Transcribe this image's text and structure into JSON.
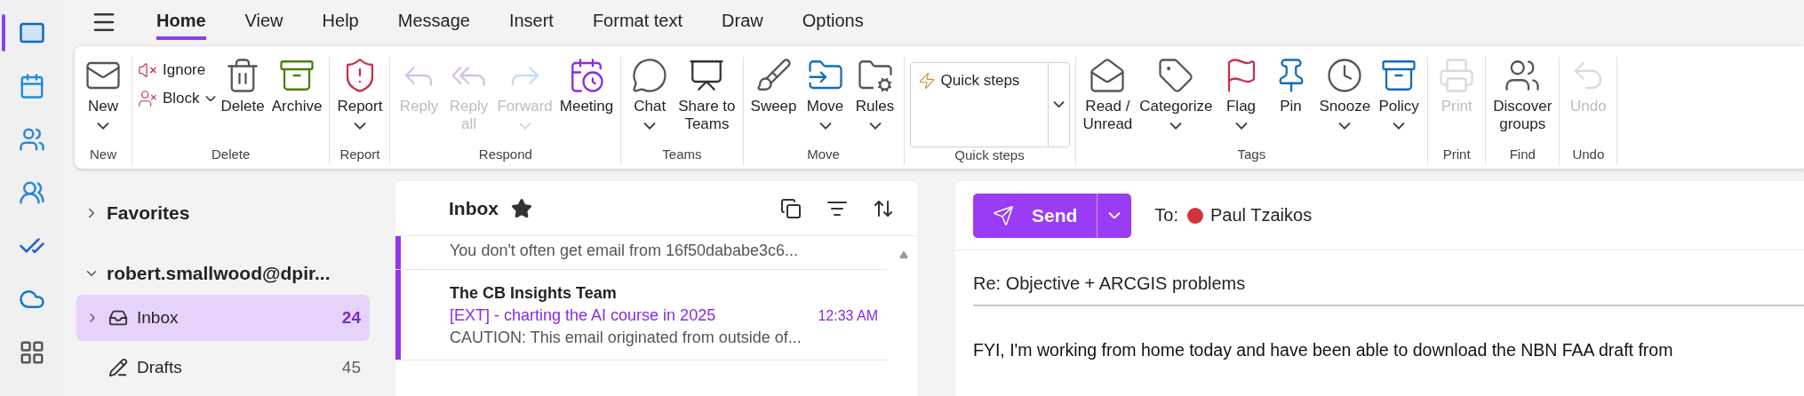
{
  "app_rail": [
    {
      "selected": true
    },
    {
      "selected": false
    },
    {
      "selected": false
    },
    {
      "selected": false
    },
    {
      "selected": false
    },
    {
      "selected": false
    },
    {
      "selected": false
    }
  ],
  "tabs": [
    {
      "label": "Home",
      "selected": true
    },
    {
      "label": "View",
      "selected": false
    },
    {
      "label": "Help",
      "selected": false
    },
    {
      "label": "Message",
      "selected": false
    },
    {
      "label": "Insert",
      "selected": false
    },
    {
      "label": "Format text",
      "selected": false
    },
    {
      "label": "Draw",
      "selected": false
    },
    {
      "label": "Options",
      "selected": false
    }
  ],
  "ribbon": {
    "groups": [
      {
        "label": "New",
        "items": [
          {
            "kind": "large",
            "label": "New",
            "dropdown": true,
            "disabled": false
          }
        ]
      },
      {
        "label": "Delete",
        "items": [
          {
            "kind": "small",
            "label": "Ignore",
            "dropdown": false,
            "disabled": false
          },
          {
            "kind": "small",
            "label": "Block",
            "dropdown": true,
            "disabled": false
          },
          {
            "kind": "large",
            "label": "Delete",
            "dropdown": false,
            "disabled": false
          },
          {
            "kind": "large",
            "label": "Archive",
            "dropdown": false,
            "disabled": false
          }
        ]
      },
      {
        "label": "Report",
        "items": [
          {
            "kind": "large",
            "label": "Report",
            "dropdown": true,
            "disabled": false
          }
        ]
      },
      {
        "label": "Respond",
        "items": [
          {
            "kind": "large",
            "label": "Reply",
            "dropdown": false,
            "disabled": true
          },
          {
            "kind": "large",
            "label": "Reply\nall",
            "dropdown": false,
            "disabled": true
          },
          {
            "kind": "large",
            "label": "Forward",
            "dropdown": true,
            "disabled": true
          },
          {
            "kind": "large",
            "label": "Meeting",
            "dropdown": false,
            "disabled": false
          }
        ]
      },
      {
        "label": "Teams",
        "items": [
          {
            "kind": "large",
            "label": "Chat",
            "dropdown": true,
            "disabled": false
          },
          {
            "kind": "large",
            "label": "Share to\nTeams",
            "dropdown": false,
            "disabled": false
          }
        ]
      },
      {
        "label": "Move",
        "items": [
          {
            "kind": "large",
            "label": "Sweep",
            "dropdown": false,
            "disabled": false
          },
          {
            "kind": "large",
            "label": "Move",
            "dropdown": true,
            "disabled": false
          },
          {
            "kind": "large",
            "label": "Rules",
            "dropdown": true,
            "disabled": false
          }
        ]
      },
      {
        "label": "Quick steps",
        "items": [
          {
            "kind": "gallery",
            "label": "Quick steps",
            "dropdown": true
          }
        ]
      },
      {
        "label": "Tags",
        "items": [
          {
            "kind": "large",
            "label": "Read /\nUnread",
            "dropdown": false,
            "disabled": false
          },
          {
            "kind": "large",
            "label": "Categorize",
            "dropdown": true,
            "disabled": false
          },
          {
            "kind": "large",
            "label": "Flag",
            "dropdown": true,
            "disabled": false
          },
          {
            "kind": "large",
            "label": "Pin",
            "dropdown": false,
            "disabled": false
          },
          {
            "kind": "large",
            "label": "Snooze",
            "dropdown": true,
            "disabled": false
          },
          {
            "kind": "large",
            "label": "Policy",
            "dropdown": true,
            "disabled": false
          }
        ]
      },
      {
        "label": "Print",
        "items": [
          {
            "kind": "large",
            "label": "Print",
            "dropdown": false,
            "disabled": true
          }
        ]
      },
      {
        "label": "Find",
        "items": [
          {
            "kind": "large",
            "label": "Discover\ngroups",
            "dropdown": false,
            "disabled": false
          }
        ]
      },
      {
        "label": "Undo",
        "items": [
          {
            "kind": "large",
            "label": "Undo",
            "dropdown": false,
            "disabled": true
          }
        ]
      }
    ]
  },
  "folders": [
    {
      "label": "Favorites",
      "expanded": false
    },
    {
      "label": "robert.smallwood@dpir...",
      "expanded": true,
      "children": [
        {
          "label": "Inbox",
          "count": "24",
          "selected": true,
          "expanded": false
        },
        {
          "label": "Drafts",
          "count": "45",
          "selected": false
        }
      ]
    }
  ],
  "message_list": {
    "title": "Inbox",
    "items": [
      {
        "unread": true,
        "preview": "You don't often get email from 16f50dababe3c6..."
      },
      {
        "unread": true,
        "sender": "The CB Insights Team",
        "subject": "[EXT] - charting the AI course in 2025",
        "time": "12:33 AM",
        "preview": "CAUTION: This email originated from outside of..."
      }
    ]
  },
  "compose": {
    "send_label": "Send",
    "to_label": "To:",
    "recipients": [
      {
        "name": "Paul Tzaikos",
        "color": "#d13438"
      }
    ],
    "subject": "Re: Objective + ARCGIS problems",
    "body": "FYI, I'm working from home today and have been able to download the NBN FAA draft from"
  }
}
